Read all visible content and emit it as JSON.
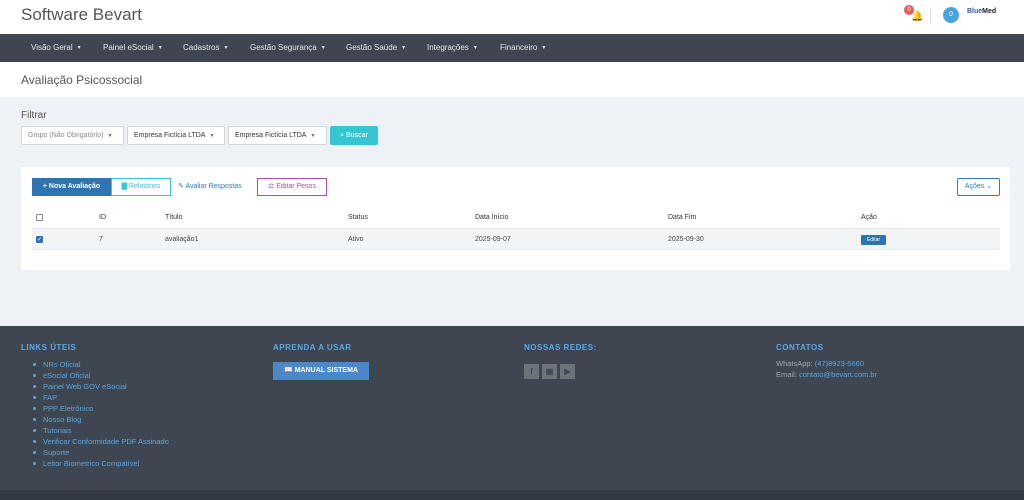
{
  "header": {
    "brand": "Software Bevart",
    "notifications_count": "0",
    "avatar_initial": "0",
    "logo_part1": "Blue",
    "logo_part2": "Med"
  },
  "nav": {
    "items": [
      {
        "label": "Visão Geral"
      },
      {
        "label": "Painel eSocial"
      },
      {
        "label": "Cadastros"
      },
      {
        "label": "Gestão Segurança"
      },
      {
        "label": "Gestão Saúde"
      },
      {
        "label": "Integrações"
      },
      {
        "label": "Financeiro"
      }
    ]
  },
  "page": {
    "title": "Avaliação Psicossocial"
  },
  "filter": {
    "label": "Filtrar",
    "group_select": "Grupo (Não Obrigatório)",
    "company_select_1": "Empresa Fictícia LTDA",
    "company_select_2": "Empresa Fictícia LTDA",
    "search_button": "Buscar"
  },
  "toolbar": {
    "new_button": "Nova Avaliação",
    "reports_button": "Relatórios",
    "evaluate_link": "Avaliar Respostas",
    "weights_button": "Editar Pesos",
    "actions_button": "Ações"
  },
  "table": {
    "columns": [
      "ID",
      "Título",
      "Status",
      "Data Início",
      "Data Fim",
      "Ação"
    ],
    "rows": [
      {
        "selected": true,
        "id": "7",
        "title": "avaliação1",
        "status": "Ativo",
        "start": "2025-09-07",
        "end": "2025-09-30",
        "action": "Editar"
      }
    ]
  },
  "footer": {
    "links_title": "LINKS ÚTEIS",
    "links": [
      "NRs Oficial",
      "eSocial Oficial",
      "Painel Web GOV eSocial",
      "FAP",
      "PPP Eletrônico",
      "Nosso Blog",
      "Tutoriais",
      "Verificar Conformidade PDF Assinado",
      "Suporte",
      "Leitor Biometrico Compatível"
    ],
    "learn_title": "APRENDA A USAR",
    "manual_button": "MANUAL SISTEMA",
    "social_title": "NOSSAS REDES:",
    "contacts_title": "CONTATOS",
    "whatsapp_label": "WhatsApp:",
    "whatsapp_value": "(47)8923-5660",
    "email_label": "Email:",
    "email_value": "contato@bevart.com.br"
  },
  "colors": {
    "navbar": "#3d4651",
    "primary": "#2d74b3",
    "accent_cyan": "#36c6d3",
    "accent_purple": "#a94ea6",
    "link": "#5ea6e0"
  }
}
